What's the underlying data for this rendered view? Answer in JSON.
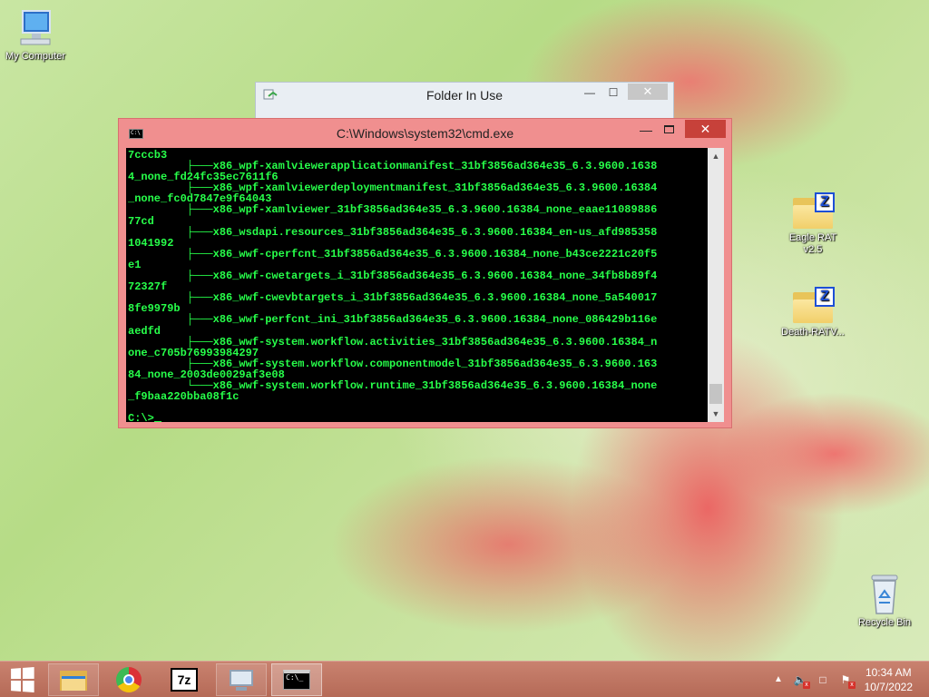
{
  "desktop": {
    "icons": [
      {
        "label": "My Computer",
        "icon": "computer-icon"
      },
      {
        "label": "Eagle RAT v2.5",
        "icon": "zip-folder-icon"
      },
      {
        "label": "Death-RATV...",
        "icon": "zip-folder-icon"
      },
      {
        "label": "Recycle Bin",
        "icon": "recycle-bin-icon"
      }
    ]
  },
  "background_window": {
    "title": "Folder In Use",
    "minimize": "—",
    "maximize": "☐",
    "close": "✕"
  },
  "cmd_window": {
    "title": "C:\\Windows\\system32\\cmd.exe",
    "minimize": "—",
    "close": "✕",
    "console_lines": [
      "7cccb3",
      "         ├───x86_wpf-xamlviewerapplicationmanifest_31bf3856ad364e35_6.3.9600.1638",
      "4_none_fd24fc35ec7611f6",
      "         ├───x86_wpf-xamlviewerdeploymentmanifest_31bf3856ad364e35_6.3.9600.16384",
      "_none_fc0d7847e9f64043",
      "         ├───x86_wpf-xamlviewer_31bf3856ad364e35_6.3.9600.16384_none_eaae11089886",
      "77cd",
      "         ├───x86_wsdapi.resources_31bf3856ad364e35_6.3.9600.16384_en-us_afd985358",
      "1041992",
      "         ├───x86_wwf-cperfcnt_31bf3856ad364e35_6.3.9600.16384_none_b43ce2221c20f5",
      "e1",
      "         ├───x86_wwf-cwetargets_i_31bf3856ad364e35_6.3.9600.16384_none_34fb8b89f4",
      "72327f",
      "         ├───x86_wwf-cwevbtargets_i_31bf3856ad364e35_6.3.9600.16384_none_5a540017",
      "8fe9979b",
      "         ├───x86_wwf-perfcnt_ini_31bf3856ad364e35_6.3.9600.16384_none_086429b116e",
      "aedfd",
      "         ├───x86_wwf-system.workflow.activities_31bf3856ad364e35_6.3.9600.16384_n",
      "one_c705b76993984297",
      "         ├───x86_wwf-system.workflow.componentmodel_31bf3856ad364e35_6.3.9600.163",
      "84_none_2003de0029af3e08",
      "         └───x86_wwf-system.workflow.runtime_31bf3856ad364e35_6.3.9600.16384_none",
      "_f9baa220bba08f1c",
      ""
    ],
    "prompt": "C:\\>"
  },
  "taskbar": {
    "buttons": [
      {
        "name": "start",
        "icon": "windows-logo-icon"
      },
      {
        "name": "file-explorer",
        "icon": "folder-icon"
      },
      {
        "name": "chrome",
        "icon": "chrome-icon"
      },
      {
        "name": "7zip",
        "icon": "7zip-icon",
        "text": "7z"
      },
      {
        "name": "resource-monitor",
        "icon": "monitor-icon"
      },
      {
        "name": "cmd",
        "icon": "cmd-icon",
        "text": "C:\\_"
      }
    ],
    "tray": {
      "time": "10:34 AM",
      "date": "10/7/2022"
    }
  }
}
